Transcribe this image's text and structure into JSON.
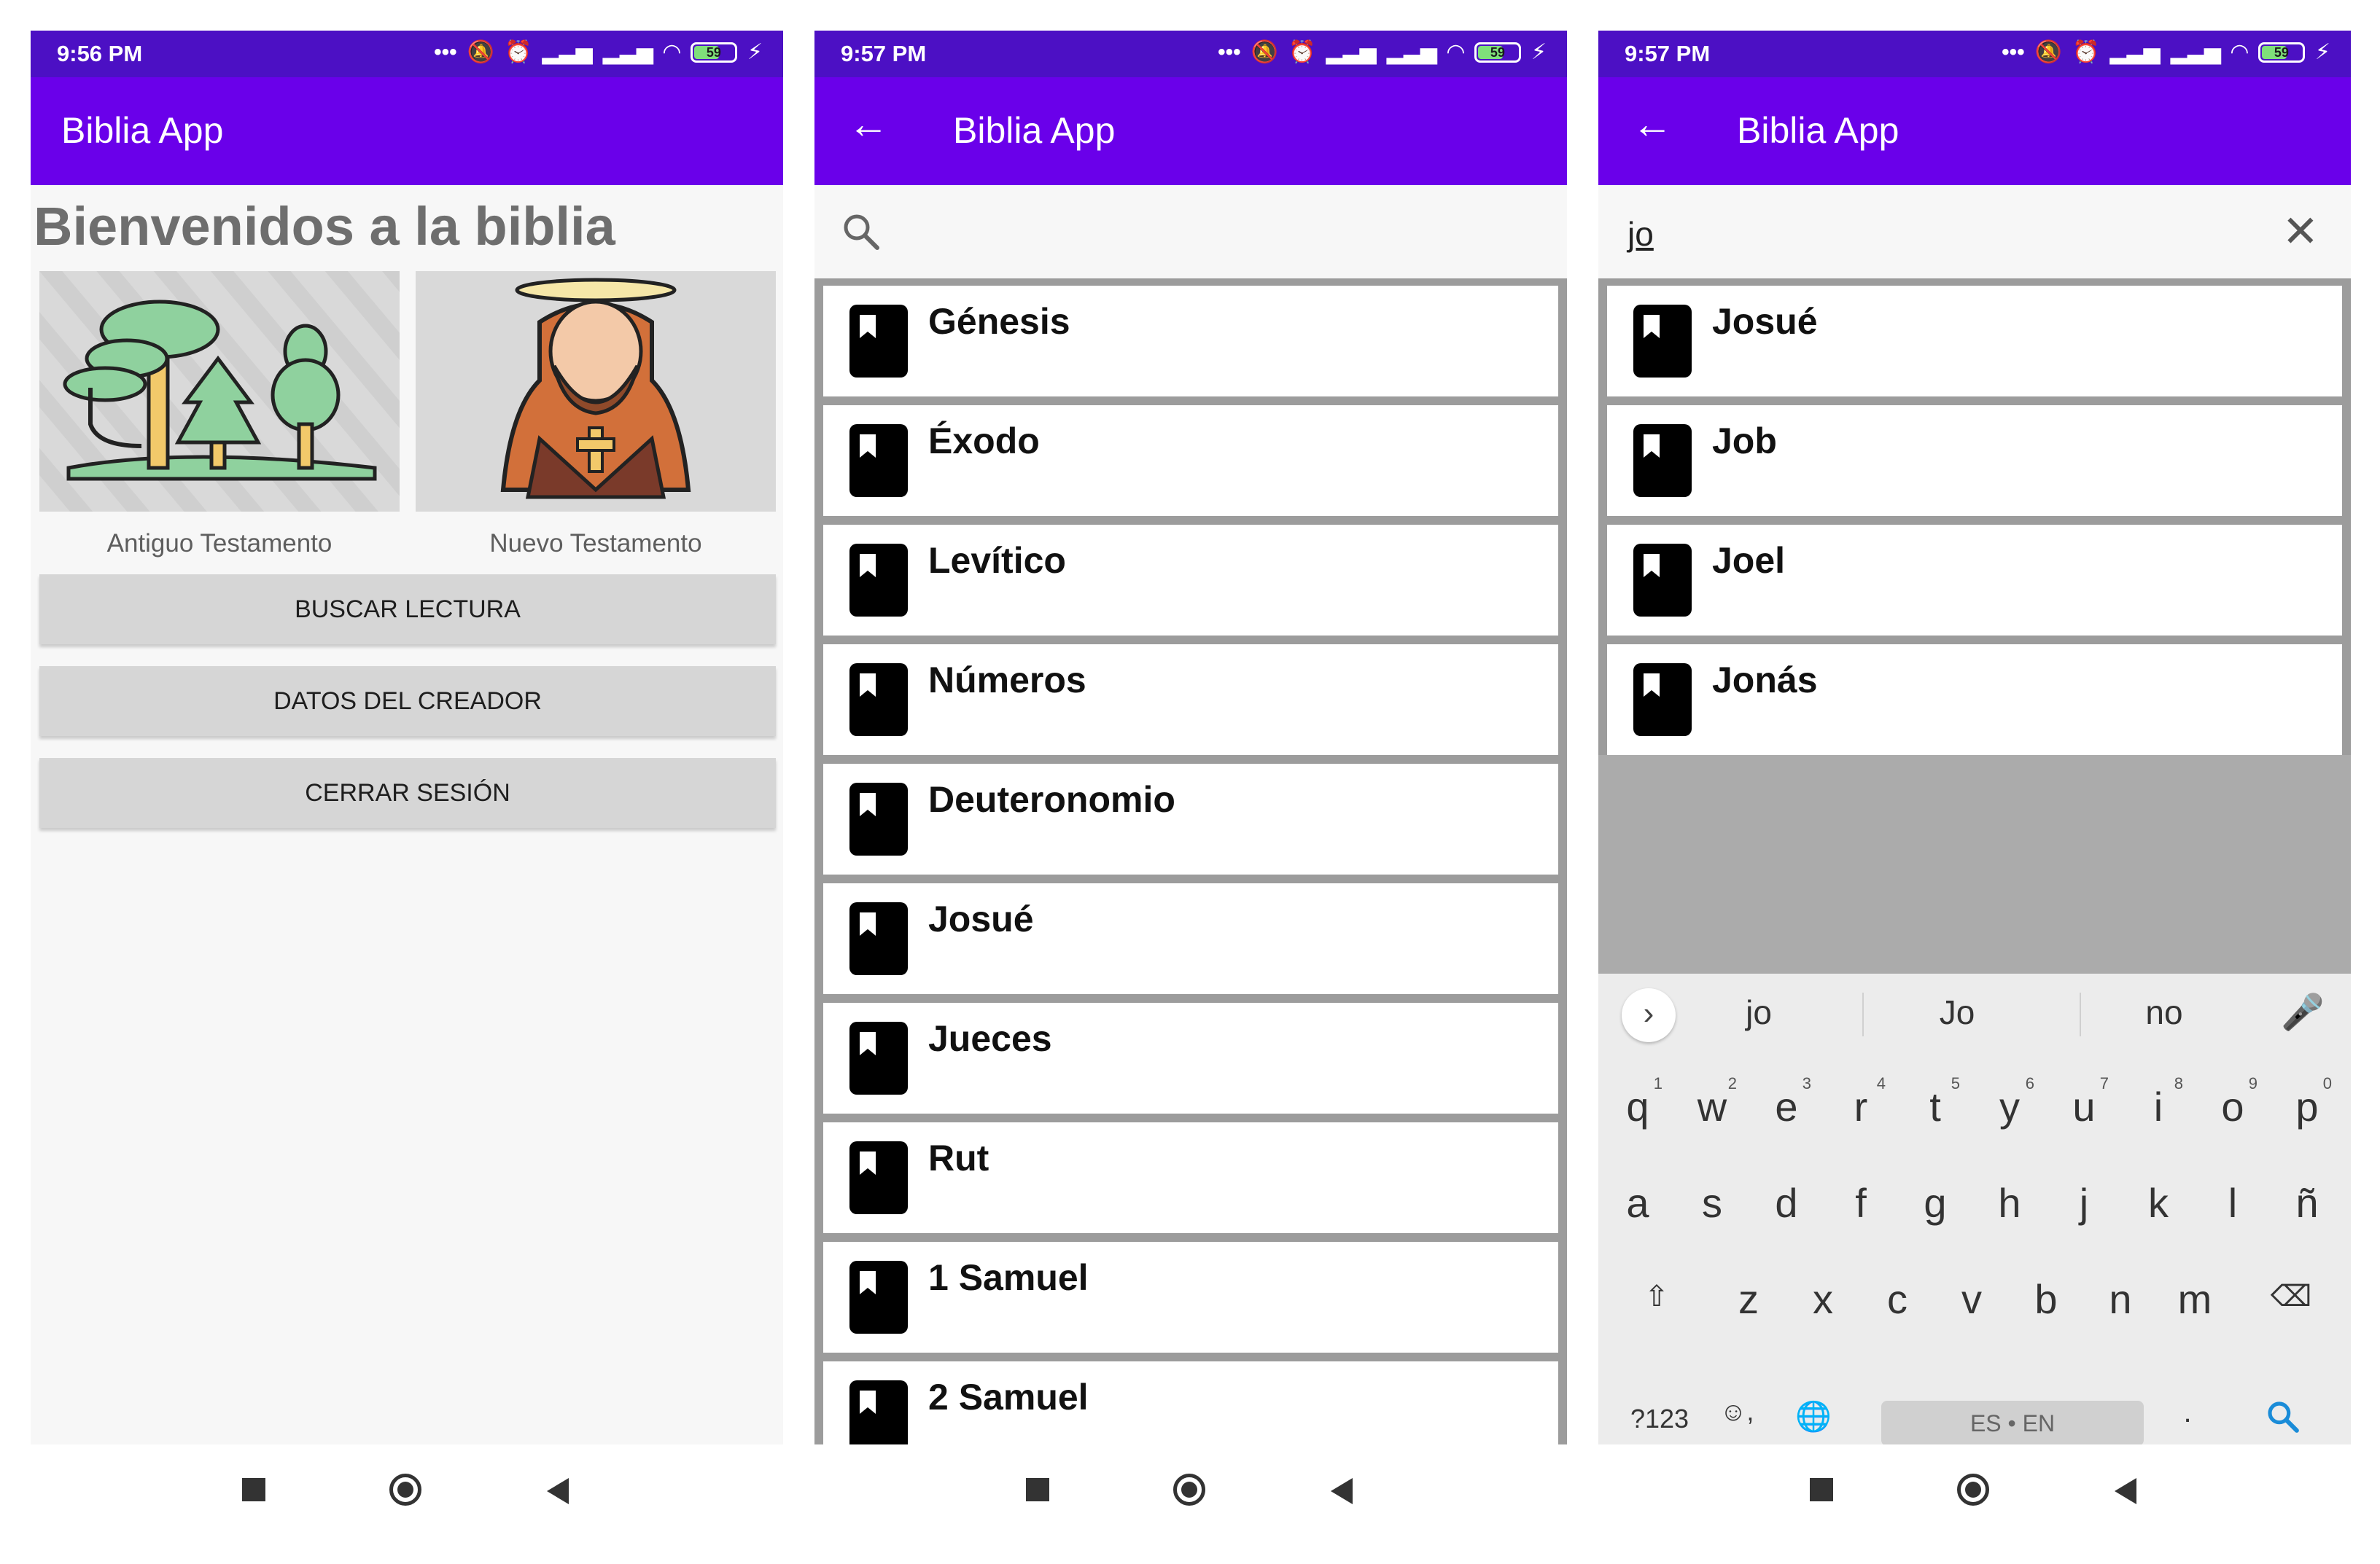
{
  "app_title": "Biblia App",
  "screens": {
    "home": {
      "status_time": "9:56 PM",
      "battery": "59",
      "welcome": "Bienvenidos a la biblia",
      "cards": [
        {
          "label": "Antiguo Testamento"
        },
        {
          "label": "Nuevo Testamento"
        }
      ],
      "buttons": [
        "BUSCAR LECTURA",
        "DATOS DEL CREADOR",
        "CERRAR SESIÓN"
      ]
    },
    "list": {
      "status_time": "9:57 PM",
      "battery": "59",
      "search_value": "",
      "books": [
        "Génesis",
        "Éxodo",
        "Levítico",
        "Números",
        "Deuteronomio",
        "Josué",
        "Jueces",
        "Rut",
        "1 Samuel",
        "2 Samuel"
      ]
    },
    "search": {
      "status_time": "9:57 PM",
      "battery": "59",
      "search_value": "jo",
      "results": [
        "Josué",
        "Job",
        "Joel",
        "Jonás"
      ],
      "keyboard": {
        "suggestions": [
          "jo",
          "Jo",
          "no"
        ],
        "row1": [
          "q",
          "w",
          "e",
          "r",
          "t",
          "y",
          "u",
          "i",
          "o",
          "p"
        ],
        "row1_hints": [
          "1",
          "2",
          "3",
          "4",
          "5",
          "6",
          "7",
          "8",
          "9",
          "0"
        ],
        "row2": [
          "a",
          "s",
          "d",
          "f",
          "g",
          "h",
          "j",
          "k",
          "l",
          "ñ"
        ],
        "row3": [
          "z",
          "x",
          "c",
          "v",
          "b",
          "n",
          "m"
        ],
        "symbols_key": "?123",
        "comma_key": ",",
        "space_label": "ES • EN",
        "period_key": "."
      }
    }
  },
  "icons": {
    "back": "arrow-left-icon",
    "search": "search-icon",
    "clear": "close-icon",
    "book": "book-icon"
  },
  "colors": {
    "status_bar": "#4c10c4",
    "app_bar": "#6a00ea",
    "accent_search": "#1a8cd8"
  }
}
